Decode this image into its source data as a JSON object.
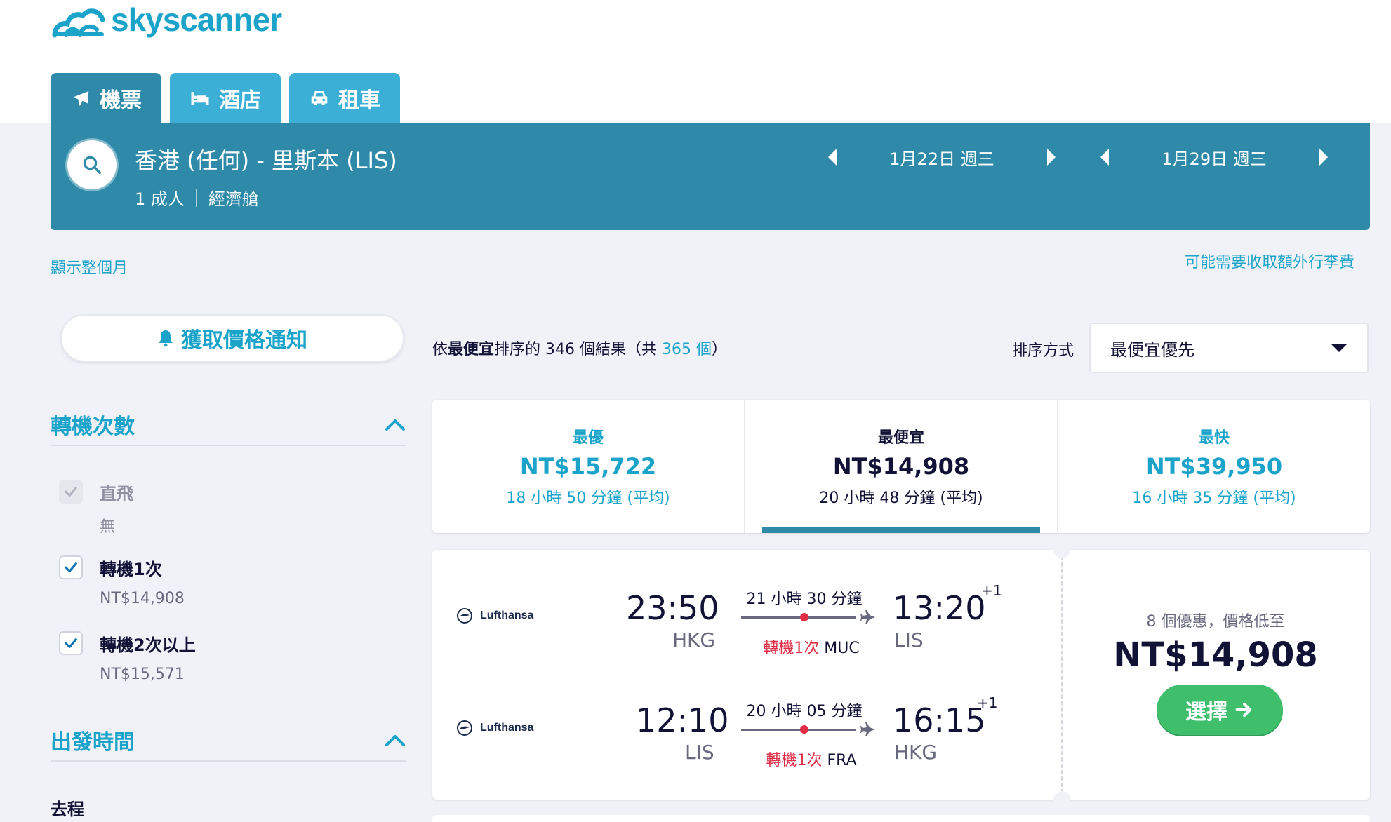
{
  "brand": {
    "name": "skyscanner"
  },
  "tabs": [
    {
      "label": "機票",
      "icon": "plane-icon"
    },
    {
      "label": "酒店",
      "icon": "bed-icon"
    },
    {
      "label": "租車",
      "icon": "car-icon"
    }
  ],
  "search": {
    "route": "香港 (任何) - 里斯本 (LIS)",
    "passengers": "1 成人",
    "cabin": "經濟艙",
    "depart_date": "1月22日 週三",
    "return_date": "1月29日 週三"
  },
  "links": {
    "show_month": "顯示整個月",
    "baggage_fees": "可能需要收取額外行李費"
  },
  "price_alert": {
    "label": "獲取價格通知"
  },
  "filters": {
    "stops": {
      "title": "轉機次數",
      "options": [
        {
          "label": "直飛",
          "sub": "無",
          "checked": true,
          "disabled": true
        },
        {
          "label": "轉機1次",
          "sub": "NT$14,908",
          "checked": true,
          "disabled": false
        },
        {
          "label": "轉機2次以上",
          "sub": "NT$15,571",
          "checked": true,
          "disabled": false
        }
      ]
    },
    "departure_time": {
      "title": "出發時間",
      "outbound": "去程"
    }
  },
  "results": {
    "prefix": "依",
    "sort_word": "最便宜",
    "middle": "排序的 346 個結果（共 ",
    "total": "365 個",
    "suffix": "）"
  },
  "sort": {
    "label": "排序方式",
    "selected": "最便宜優先"
  },
  "sort_tabs": [
    {
      "name": "最優",
      "price": "NT$15,722",
      "time": "18 小時 50 分鐘 (平均)",
      "style": "blue"
    },
    {
      "name": "最便宜",
      "price": "NT$14,908",
      "time": "20 小時 48 分鐘 (平均)",
      "style": "dark"
    },
    {
      "name": "最快",
      "price": "NT$39,950",
      "time": "16 小時 35 分鐘 (平均)",
      "style": "blue"
    }
  ],
  "itinerary": {
    "legs": [
      {
        "airline": "Lufthansa",
        "depart_time": "23:50",
        "depart_code": "HKG",
        "duration": "21 小時 30 分鐘",
        "stops": "轉機1次",
        "stop_code": "MUC",
        "arrive_time": "13:20",
        "arrive_code": "LIS",
        "day_offset": "+1"
      },
      {
        "airline": "Lufthansa",
        "depart_time": "12:10",
        "depart_code": "LIS",
        "duration": "20 小時 05 分鐘",
        "stops": "轉機1次",
        "stop_code": "FRA",
        "arrive_time": "16:15",
        "arrive_code": "HKG",
        "day_offset": "+1"
      }
    ],
    "deals": "8 個優惠，價格低至",
    "price": "NT$14,908",
    "select_label": "選擇"
  },
  "colors": {
    "brand": "#1ba3c9",
    "header_band": "#2e8aa8",
    "select_button": "#3fbf6b",
    "stop_red": "#e02d45"
  }
}
